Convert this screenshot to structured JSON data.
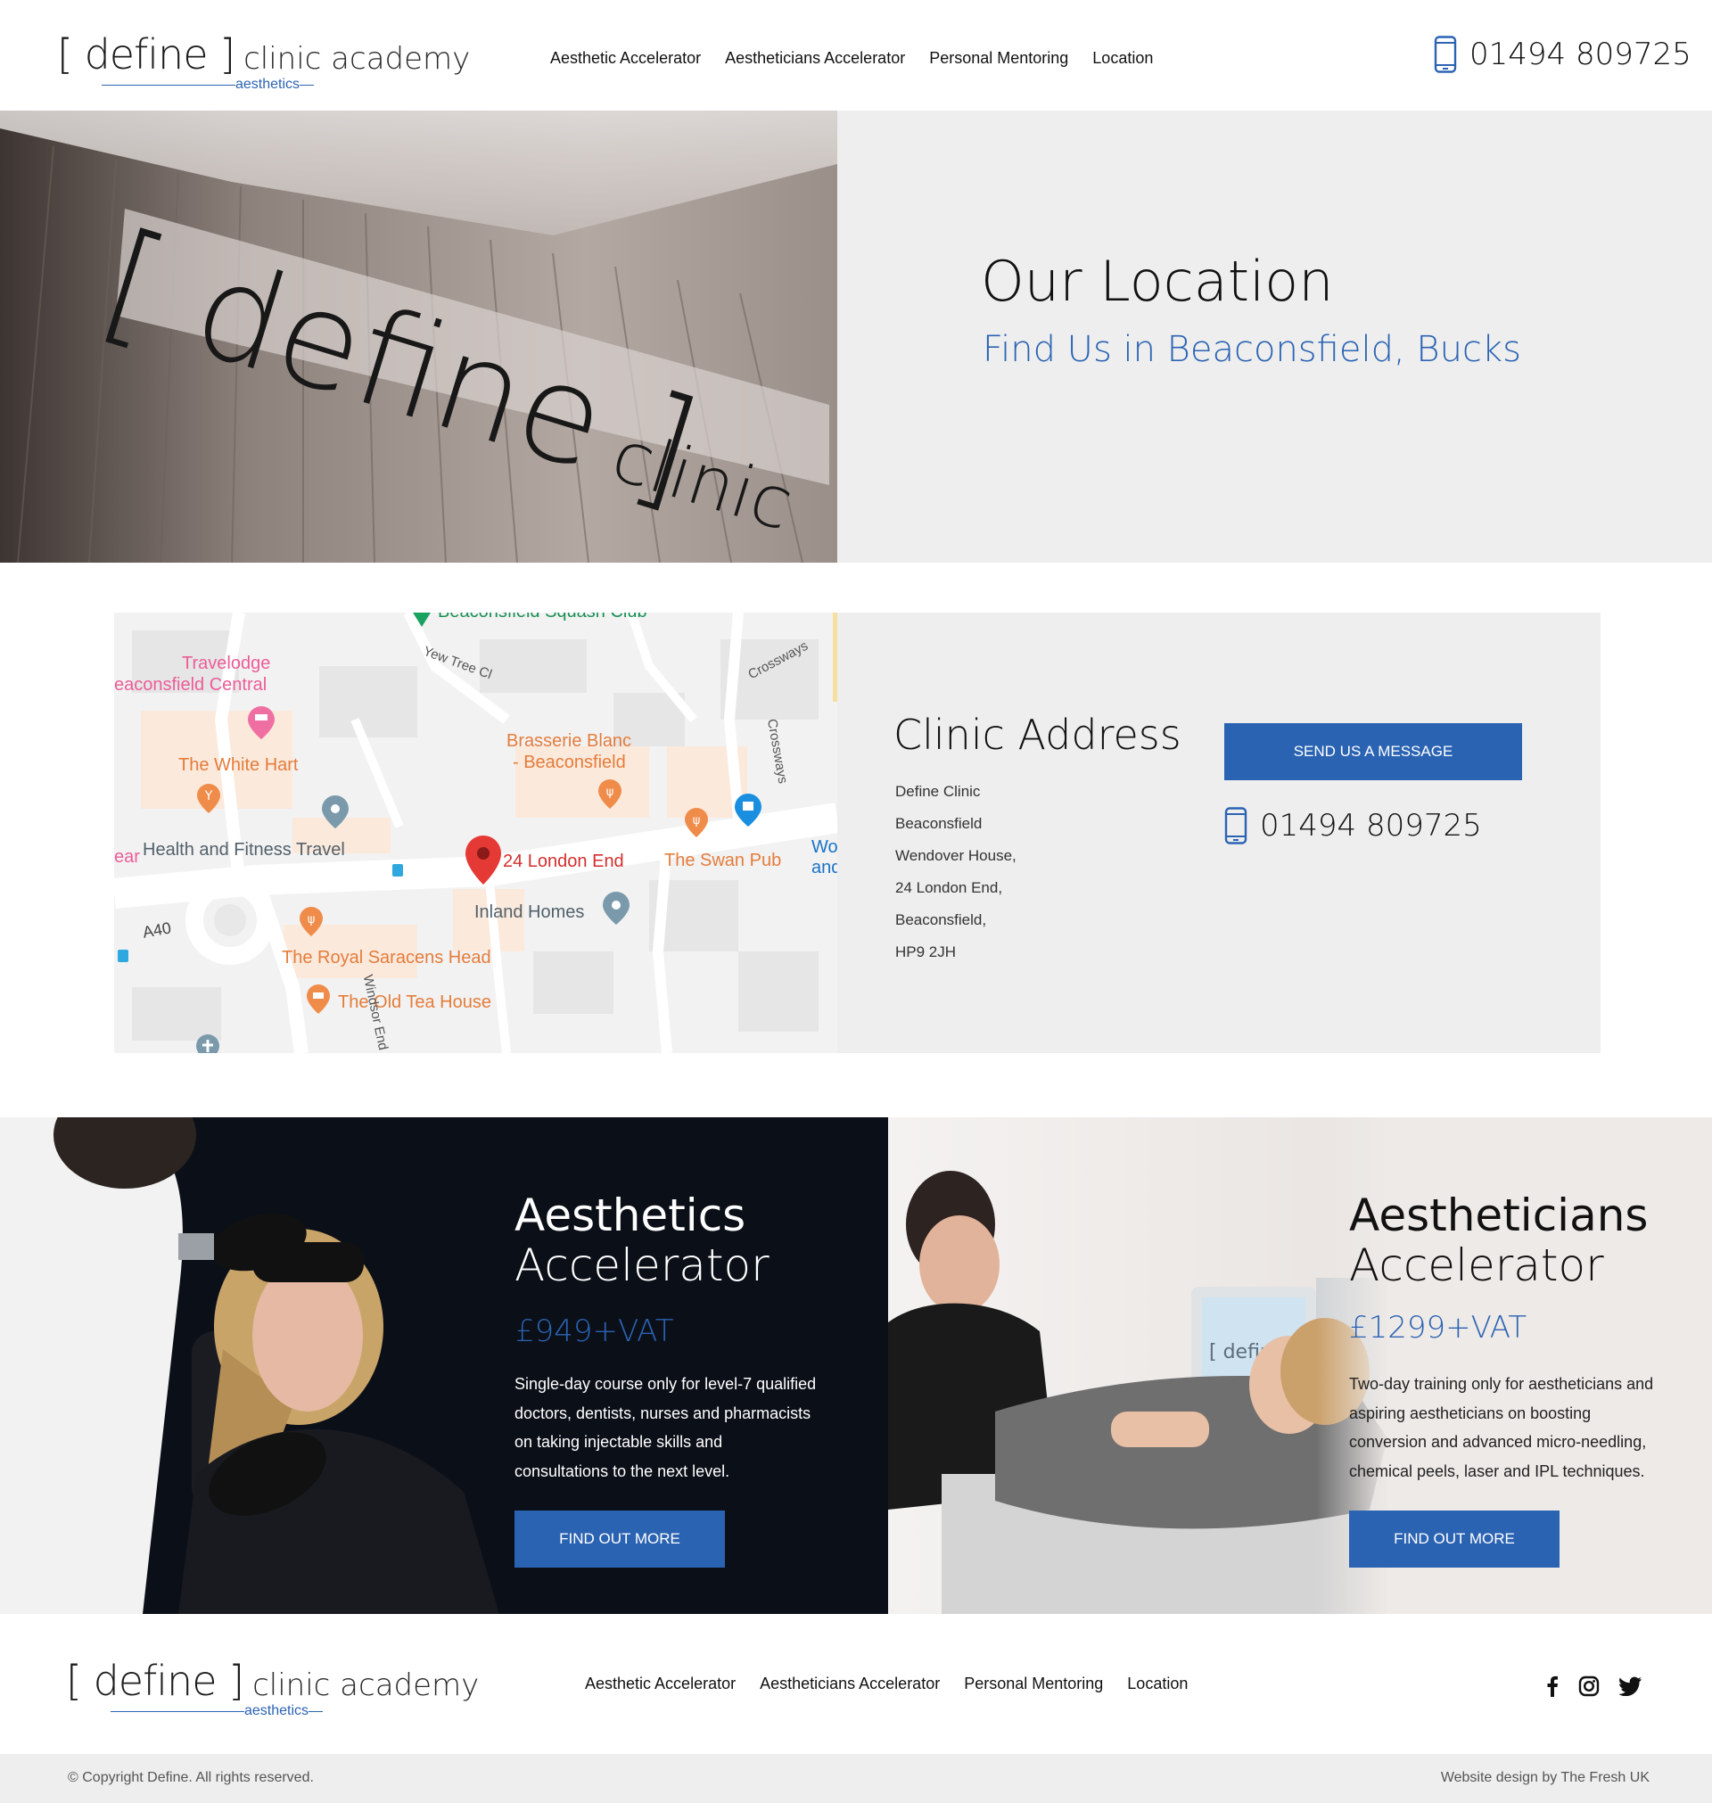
{
  "brand": {
    "logo_main": "[ define ]",
    "logo_sub": "clinic academy",
    "logo_tag": "aesthetics",
    "accent_color": "#2b63b3"
  },
  "header": {
    "nav": [
      "Aesthetic Accelerator",
      "Aestheticians Accelerator",
      "Personal Mentoring",
      "Location"
    ],
    "phone": "01494 809725",
    "phone_icon": "smartphone-icon"
  },
  "hero": {
    "title": "Our Location",
    "subtitle": "Find Us in Beaconsfield, Bucks",
    "photo_sign": {
      "main": "[ define ]",
      "sub": "clinic"
    }
  },
  "map": {
    "pin_label": "24 London End",
    "places": [
      "Travelodge",
      "eaconsfield Central",
      "The White Hart",
      "Health and Fitness Travel",
      "Brasserie Blanc",
      "- Beaconsfield",
      "The Swan Pub",
      "Inland Homes",
      "The Royal Saracens Head",
      "The Old Tea House",
      "Beaconsfield Squash Club",
      "Wo",
      "and",
      "ear"
    ],
    "streets": [
      "Yew Tree Cl",
      "Crossways",
      "Crossways",
      "A40",
      "Windsor End"
    ]
  },
  "address": {
    "title": "Clinic Address",
    "lines": [
      "Define Clinic",
      "Beaconsfield",
      "Wendover House,",
      "24 London End,",
      "Beaconsfield,",
      "HP9 2JH"
    ],
    "send_button": "SEND US A MESSAGE",
    "phone": "01494 809725"
  },
  "courses": [
    {
      "title_line1": "Aesthetics",
      "title_line2": "Accelerator",
      "price": "£949+VAT",
      "description": "Single-day course only for level-7 qualified doctors, dentists, nurses and pharmacists on taking injectable skills and consultations to the next level.",
      "button": "FIND OUT MORE"
    },
    {
      "title_line1": "Aestheticians",
      "title_line2": "Accelerator",
      "price": "£1299+VAT",
      "description": "Two-day training only for aestheticians and aspiring aestheticians on boosting conversion and advanced micro-needling, chemical peels, laser and IPL techniques.",
      "button": "FIND OUT MORE",
      "monitor_text": "[ define ] clinic"
    }
  ],
  "footer": {
    "nav": [
      "Aesthetic Accelerator",
      "Aestheticians Accelerator",
      "Personal Mentoring",
      "Location"
    ],
    "social": [
      "facebook-icon",
      "instagram-icon",
      "twitter-icon"
    ],
    "copyright": "© Copyright Define. All rights reserved.",
    "credit": "Website design by The Fresh UK"
  }
}
